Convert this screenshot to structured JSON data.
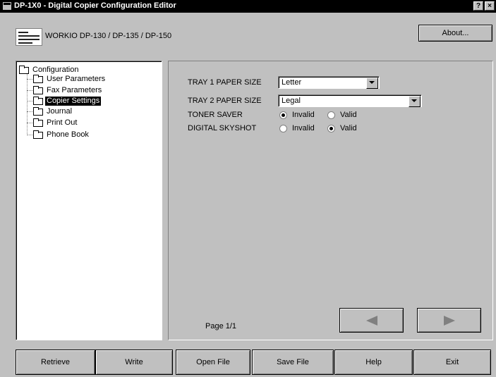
{
  "window": {
    "title": "DP-1X0 - Digital Copier Configuration Editor",
    "help_glyph": "?",
    "close_glyph": "×"
  },
  "header": {
    "product_name": "WORKIO DP-130 / DP-135 / DP-150",
    "about_label": "About..."
  },
  "tree": {
    "root": "Configuration",
    "items": [
      {
        "label": "User Parameters"
      },
      {
        "label": "Fax Parameters"
      },
      {
        "label": "Copier Settings",
        "selected": true
      },
      {
        "label": "Journal"
      },
      {
        "label": "Print Out"
      },
      {
        "label": "Phone Book"
      }
    ]
  },
  "settings": {
    "tray1": {
      "label": "TRAY 1 PAPER SIZE",
      "value": "Letter"
    },
    "tray2": {
      "label": "TRAY 2 PAPER SIZE",
      "value": "Legal"
    },
    "toner_saver": {
      "label": "TONER SAVER",
      "options": [
        "Invalid",
        "Valid"
      ],
      "selected": "Invalid"
    },
    "digital_skyshot": {
      "label": "DIGITAL SKYSHOT",
      "options": [
        "Invalid",
        "Valid"
      ],
      "selected": "Valid"
    },
    "page_indicator": "Page 1/1"
  },
  "buttons": {
    "retrieve": "Retrieve",
    "write": "Write",
    "open_file": "Open File",
    "save_file": "Save File",
    "help": "Help",
    "exit": "Exit"
  },
  "icons": {
    "title_icon": "app-window-icon",
    "folder_icon": "folder-icon",
    "prev": "left-triangle-icon",
    "next": "right-triangle-icon"
  }
}
